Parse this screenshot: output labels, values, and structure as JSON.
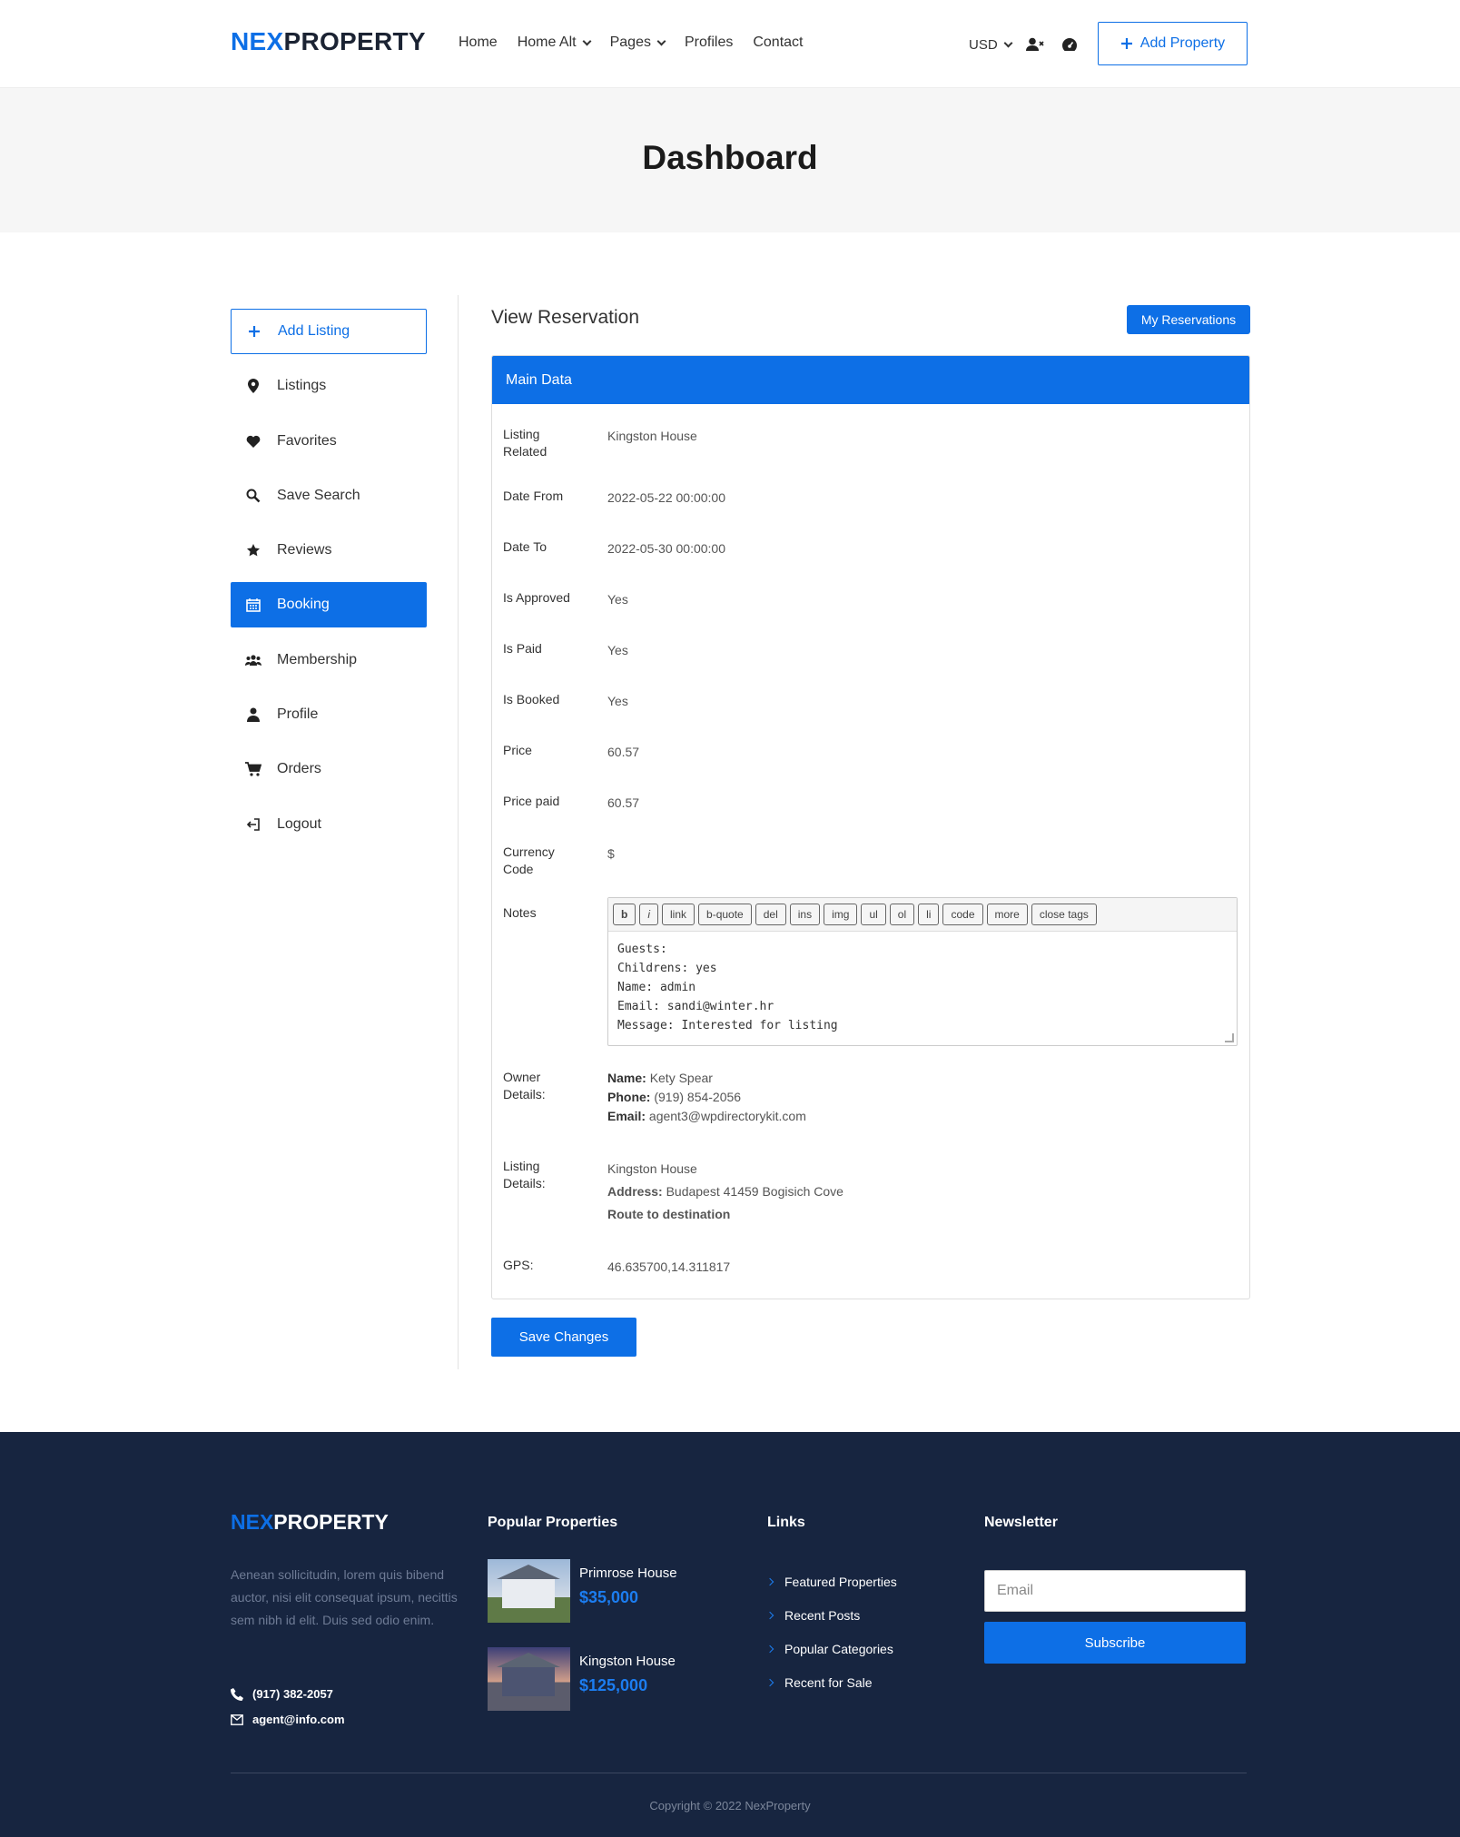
{
  "header": {
    "logo_part1": "NEX",
    "logo_part2": "PROPERTY",
    "nav": [
      "Home",
      "Home Alt",
      "Pages",
      "Profiles",
      "Contact"
    ],
    "currency": "USD",
    "add_property": "Add Property"
  },
  "page_title": "Dashboard",
  "sidebar": {
    "items": [
      {
        "label": "Add Listing",
        "icon": "plus-icon"
      },
      {
        "label": "Listings",
        "icon": "map-pin-icon"
      },
      {
        "label": "Favorites",
        "icon": "heart-icon"
      },
      {
        "label": "Save Search",
        "icon": "search-icon"
      },
      {
        "label": "Reviews",
        "icon": "star-icon"
      },
      {
        "label": "Booking",
        "icon": "calendar-icon"
      },
      {
        "label": "Membership",
        "icon": "group-icon"
      },
      {
        "label": "Profile",
        "icon": "user-icon"
      },
      {
        "label": "Orders",
        "icon": "cart-icon"
      },
      {
        "label": "Logout",
        "icon": "logout-icon"
      }
    ]
  },
  "main": {
    "title": "View Reservation",
    "my_reservations": "My Reservations",
    "panel_title": "Main Data",
    "rows": {
      "listing_related": {
        "label": "Listing Related",
        "value": "Kingston House"
      },
      "date_from": {
        "label": "Date From",
        "value": "2022-05-22 00:00:00"
      },
      "date_to": {
        "label": "Date To",
        "value": "2022-05-30 00:00:00"
      },
      "is_approved": {
        "label": "Is Approved",
        "value": "Yes"
      },
      "is_paid": {
        "label": "Is Paid",
        "value": "Yes"
      },
      "is_booked": {
        "label": "Is Booked",
        "value": "Yes"
      },
      "price": {
        "label": "Price",
        "value": "60.57"
      },
      "price_paid": {
        "label": "Price paid",
        "value": "60.57"
      },
      "currency_code": {
        "label": "Currency Code",
        "value": "$"
      }
    },
    "notes": {
      "label": "Notes",
      "toolbar": [
        "b",
        "i",
        "link",
        "b-quote",
        "del",
        "ins",
        "img",
        "ul",
        "ol",
        "li",
        "code",
        "more",
        "close tags"
      ],
      "text": "Guests: \nChildrens: yes\nName: admin\nEmail: sandi@winter.hr\nMessage: Interested for listing"
    },
    "owner": {
      "label": "Owner Details:",
      "name_label": "Name:",
      "name": "Kety Spear",
      "phone_label": "Phone:",
      "phone": "(919) 854-2056",
      "email_label": "Email:",
      "email": "agent3@wpdirectorykit.com"
    },
    "listing": {
      "label": "Listing Details:",
      "name": "Kingston House",
      "address_label": "Address:",
      "address": "Budapest 41459 Bogisich Cove",
      "route": "Route to destination"
    },
    "gps": {
      "label": "GPS:",
      "value": "46.635700,14.311817"
    },
    "save": "Save Changes"
  },
  "footer": {
    "logo_part1": "NEX",
    "logo_part2": "PROPERTY",
    "description": "Aenean sollicitudin, lorem quis bibend auctor, nisi elit consequat ipsum, necittis sem nibh id elit. Duis sed odio enim.",
    "phone": "(917) 382-2057",
    "email": "agent@info.com",
    "popular_title": "Popular Properties",
    "properties": [
      {
        "name": "Primrose House",
        "price": "$35,000"
      },
      {
        "name": "Kingston House",
        "price": "$125,000"
      }
    ],
    "links_title": "Links",
    "links": [
      "Featured Properties",
      "Recent Posts",
      "Popular Categories",
      "Recent for Sale"
    ],
    "newsletter_title": "Newsletter",
    "email_placeholder": "Email",
    "subscribe": "Subscribe",
    "copyright": "Copyright © 2022 NexProperty"
  },
  "colors": {
    "accent": "#0d6fe6",
    "footer_bg": "#172540"
  }
}
